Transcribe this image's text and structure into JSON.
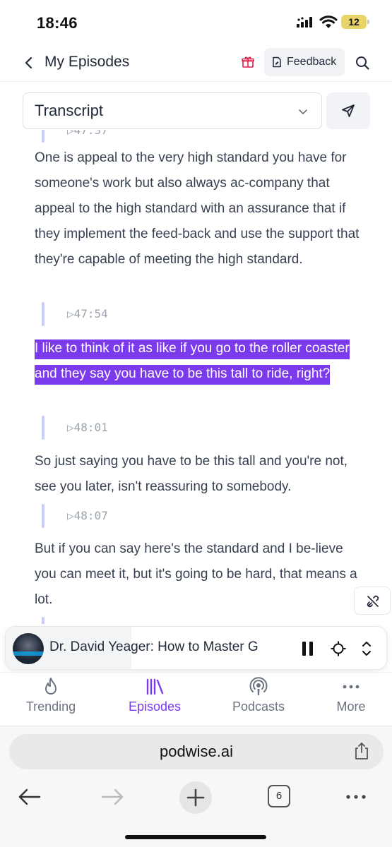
{
  "status": {
    "time": "18:46",
    "battery": "12"
  },
  "header": {
    "title": "My Episodes",
    "feedback_label": "Feedback"
  },
  "transcript": {
    "selector_value": "Transcript",
    "segments": [
      {
        "time": "47:37",
        "text": "One is appeal to the very high standard you have for someone's work but also always ac-company that appeal to the high standard with an assurance that if they implement the feed-back and use the support that they're capable of meeting the high standard."
      },
      {
        "time": "47:54",
        "text": "I like to think of it as like if you go to the roller coaster and they say you have to be this tall to ride, right?"
      },
      {
        "time": "48:01",
        "text": "So just saying you have to be this tall and you're not, see you later, isn't reassuring to somebody."
      },
      {
        "time": "48:07",
        "text": "But if you can say here's the standard and I be-lieve you can meet it, but it's going to be hard, that means a lot."
      }
    ]
  },
  "player": {
    "title": "Dr. David Yeager: How to Master G",
    "progress": 0.33
  },
  "nav": {
    "items": [
      {
        "label": "Trending",
        "icon": "flame-icon"
      },
      {
        "label": "Episodes",
        "icon": "library-icon",
        "active": true
      },
      {
        "label": "Podcasts",
        "icon": "podcast-icon"
      },
      {
        "label": "More",
        "icon": "more-icon"
      }
    ]
  },
  "browser": {
    "url": "podwise.ai",
    "tab_count": "6"
  },
  "colors": {
    "accent": "#7c3aed",
    "highlight_text": "#ffffff",
    "timestamp_bar": "#c9cdfa"
  }
}
